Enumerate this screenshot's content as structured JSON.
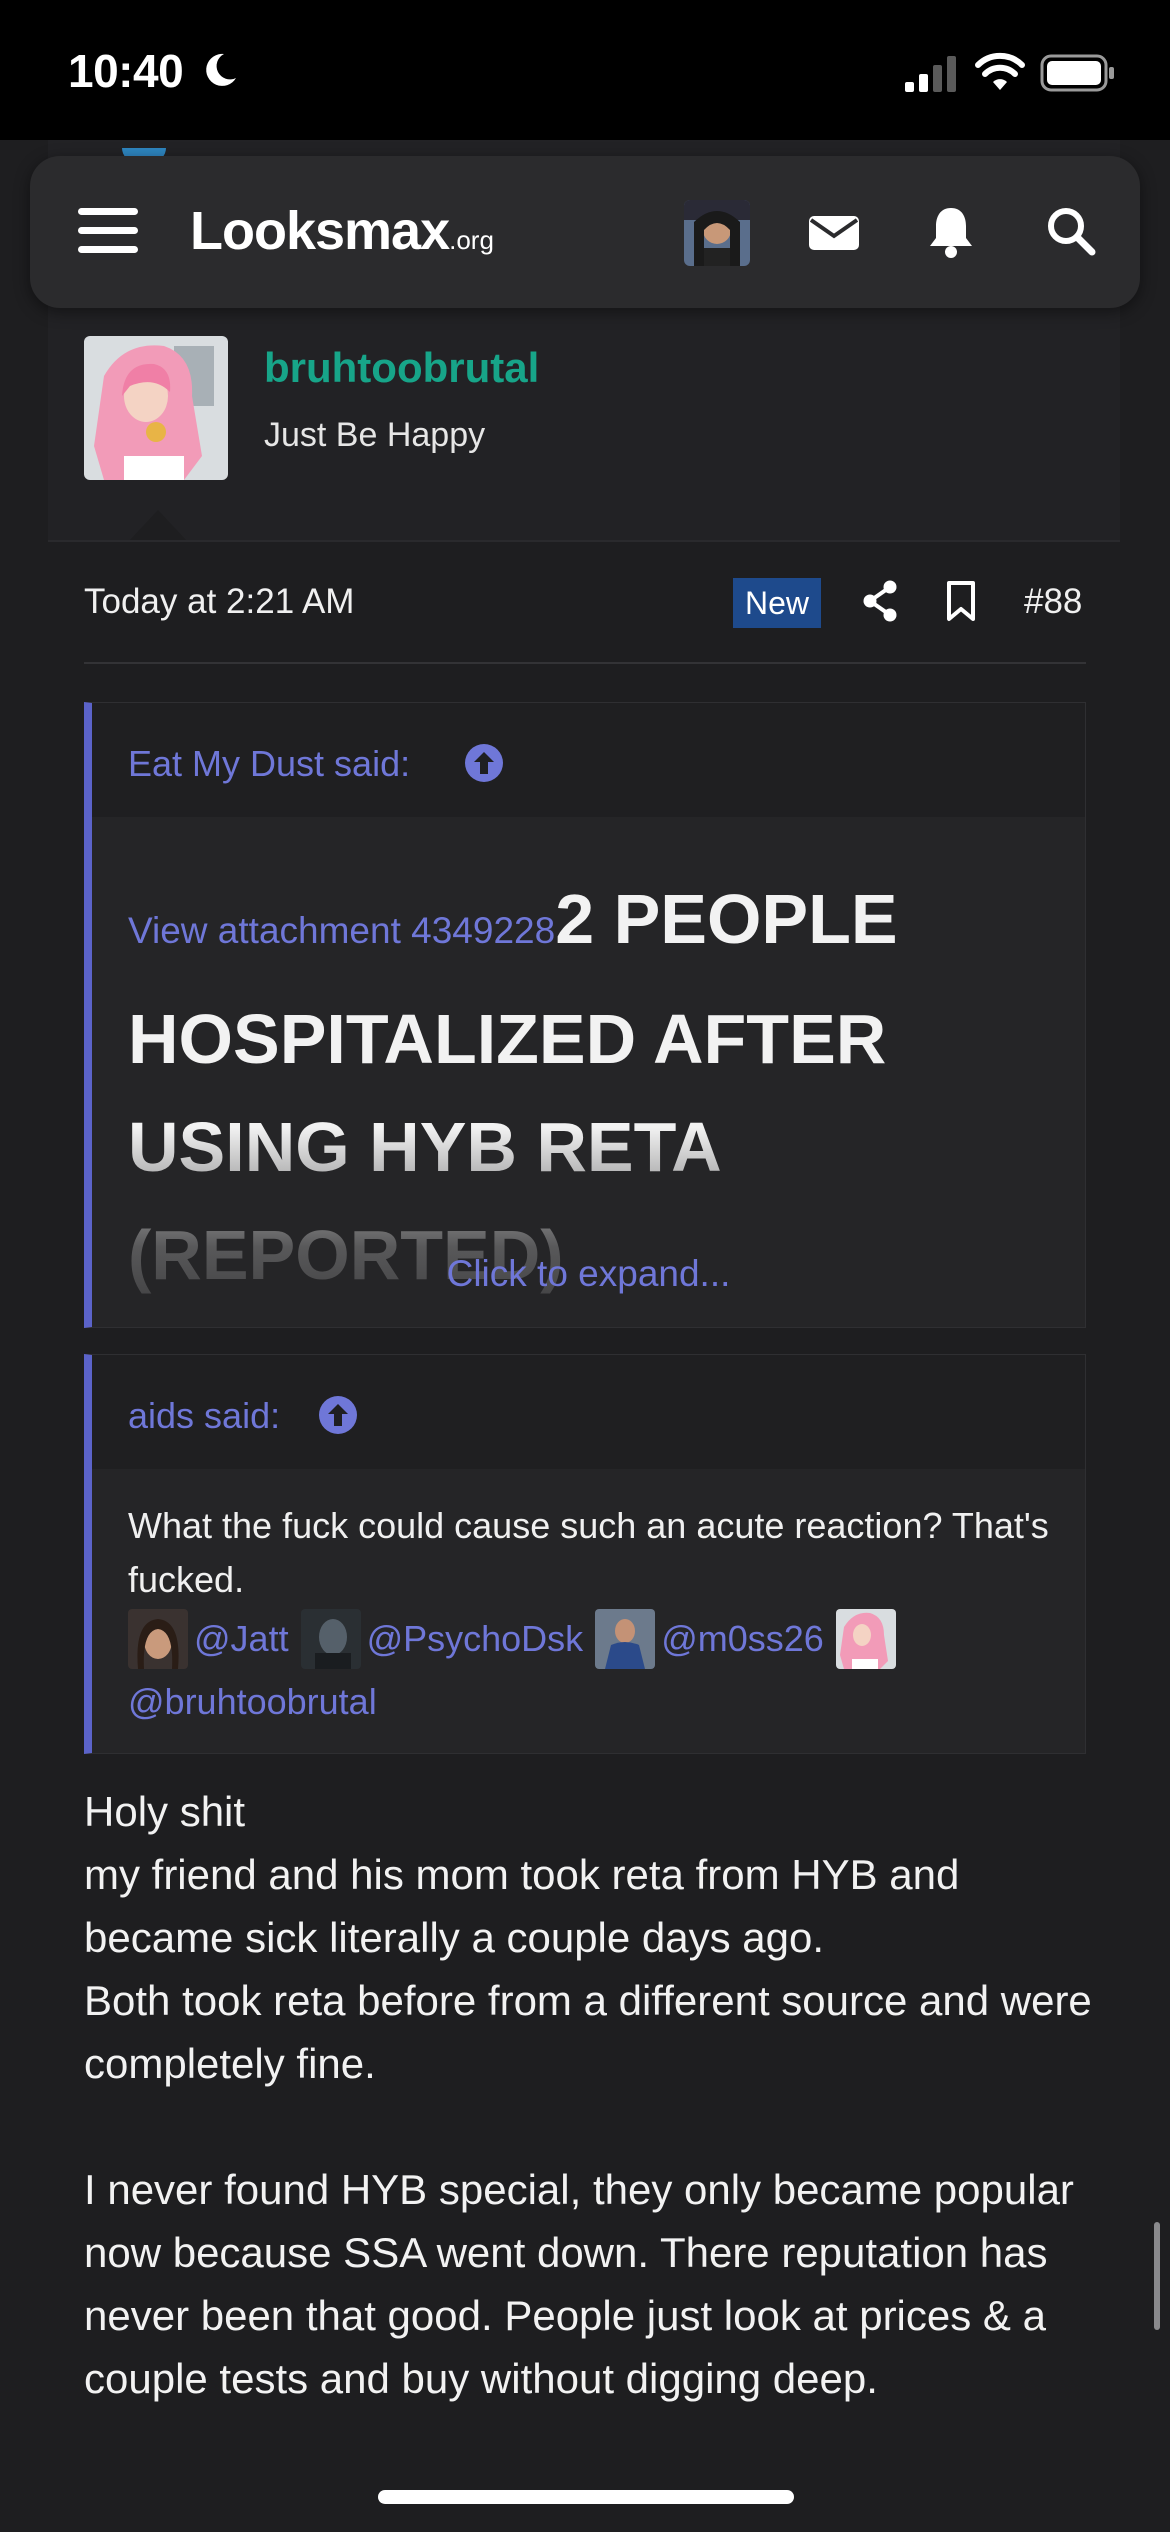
{
  "status_bar": {
    "time": "10:40"
  },
  "navbar": {
    "logo_main": "Looksmax",
    "logo_suffix": ".org"
  },
  "author": {
    "username": "bruhtoobrutal",
    "user_title": "Just Be Happy"
  },
  "post_meta": {
    "date": "Today at 2:21 AM",
    "badge": "New",
    "post_number": "#88"
  },
  "quote1": {
    "author": "Eat My Dust said:",
    "attachment_link": "View attachment 4349228",
    "headline": "2 PEOPLE HOSPITALIZED AFTER USING HYB RETA (REPORTED)",
    "expand": "Click to expand..."
  },
  "quote2": {
    "author": "aids said:",
    "text": "What the fuck could cause such an acute reaction? That's fucked.",
    "mentions": [
      "@Jatt",
      "@PsychoDsk",
      "@m0ss26",
      "@bruhtoobrutal"
    ]
  },
  "post_body": {
    "lines": [
      "Holy shit",
      "my friend and his mom took reta from HYB and became sick literally a couple days ago.",
      "Both took reta before from a different source and were completely fine."
    ],
    "paragraph2": "I never found HYB special, they only became popular now because SSA went down. There reputation has never been that good. People just look at prices & a couple tests and buy without digging deep."
  },
  "colors": {
    "accent_link": "#6f77d8",
    "username_green": "#17a589",
    "quote_bar": "#5b63c9",
    "new_badge": "#1e4a8c"
  },
  "icons": [
    "moon-icon",
    "signal-icon",
    "wifi-icon",
    "battery-icon",
    "hamburger-icon",
    "mail-icon",
    "bell-icon",
    "search-icon",
    "share-icon",
    "bookmark-icon",
    "arrow-up-circle-icon"
  ]
}
